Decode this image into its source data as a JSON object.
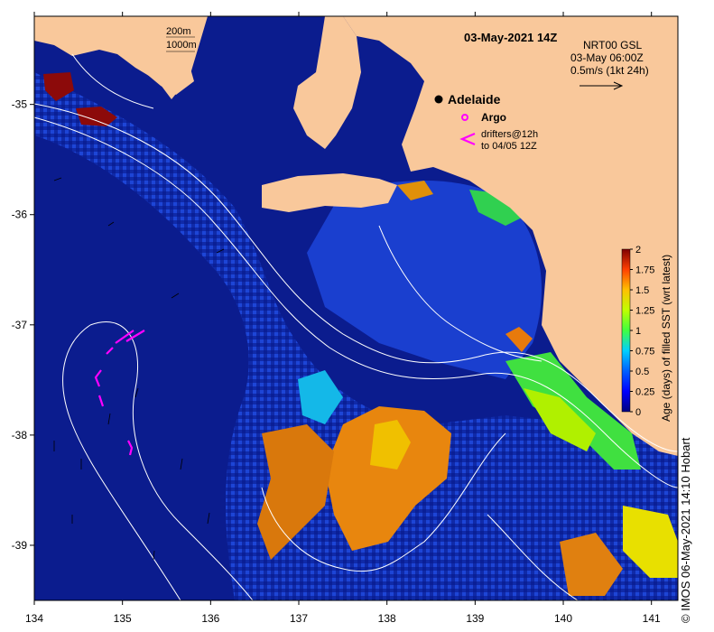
{
  "title": "03-May-2021 14Z",
  "product": {
    "line1": "NRT00 GSL",
    "line2": "03-May 06:00Z",
    "line3": "0.5m/s (1kt 24h)"
  },
  "depth_legend": [
    "200m",
    "1000m"
  ],
  "places": [
    {
      "name": "Adelaide",
      "lon": 138.6,
      "lat": -34.93
    }
  ],
  "markers_legend": {
    "argo": "Argo",
    "drifters_1": "drifters@12h",
    "drifters_2": "to 04/05 12Z"
  },
  "axes": {
    "x_ticks": [
      "134",
      "135",
      "136",
      "137",
      "138",
      "139",
      "140",
      "141"
    ],
    "y_ticks": [
      "-35",
      "-36",
      "-37",
      "-38",
      "-39"
    ],
    "lon_range": [
      134,
      141.3
    ],
    "lat_range": [
      -39.5,
      -34.2
    ]
  },
  "colorbar": {
    "label": "Age (days) of filled SST (wrt latest)",
    "ticks": [
      "2",
      "1.75",
      "1.5",
      "1.25",
      "1",
      "0.75",
      "0.5",
      "0.25",
      "0"
    ],
    "range": [
      0,
      2
    ]
  },
  "credit": "© IMOS 06-May-2021 14:10 Hobart",
  "colors": {
    "land": "#f9c89b",
    "ocean_deep": "#0a1a8c",
    "ocean_mid": "#1538c8",
    "contour": "#ffffff",
    "drifter": "#ff00ff",
    "age_scale": [
      "#00007f",
      "#0000ff",
      "#0080ff",
      "#00ffff",
      "#80ff80",
      "#ffff00",
      "#ff8000",
      "#ff0000",
      "#7f0000"
    ]
  },
  "chart_data": {
    "type": "heatmap",
    "title": "03-May-2021 14Z",
    "xlabel": "",
    "ylabel": "",
    "xlim": [
      134,
      141.3
    ],
    "ylim": [
      -39.5,
      -34.2
    ],
    "value_label": "Age (days) of filled SST (wrt latest)",
    "value_range": [
      0,
      2
    ],
    "patches": [
      {
        "lon": 134.3,
        "lat": -34.8,
        "age": 2.0
      },
      {
        "lon": 134.8,
        "lat": -35.1,
        "age": 2.0
      },
      {
        "lon": 137.9,
        "lat": -38.2,
        "age": 1.6
      },
      {
        "lon": 137.0,
        "lat": -38.4,
        "age": 1.7
      },
      {
        "lon": 138.4,
        "lat": -38.6,
        "age": 1.5
      },
      {
        "lon": 139.4,
        "lat": -37.6,
        "age": 1.1
      },
      {
        "lon": 140.5,
        "lat": -39.2,
        "age": 1.4
      },
      {
        "lon": 140.9,
        "lat": -39.0,
        "age": 1.1
      }
    ]
  }
}
